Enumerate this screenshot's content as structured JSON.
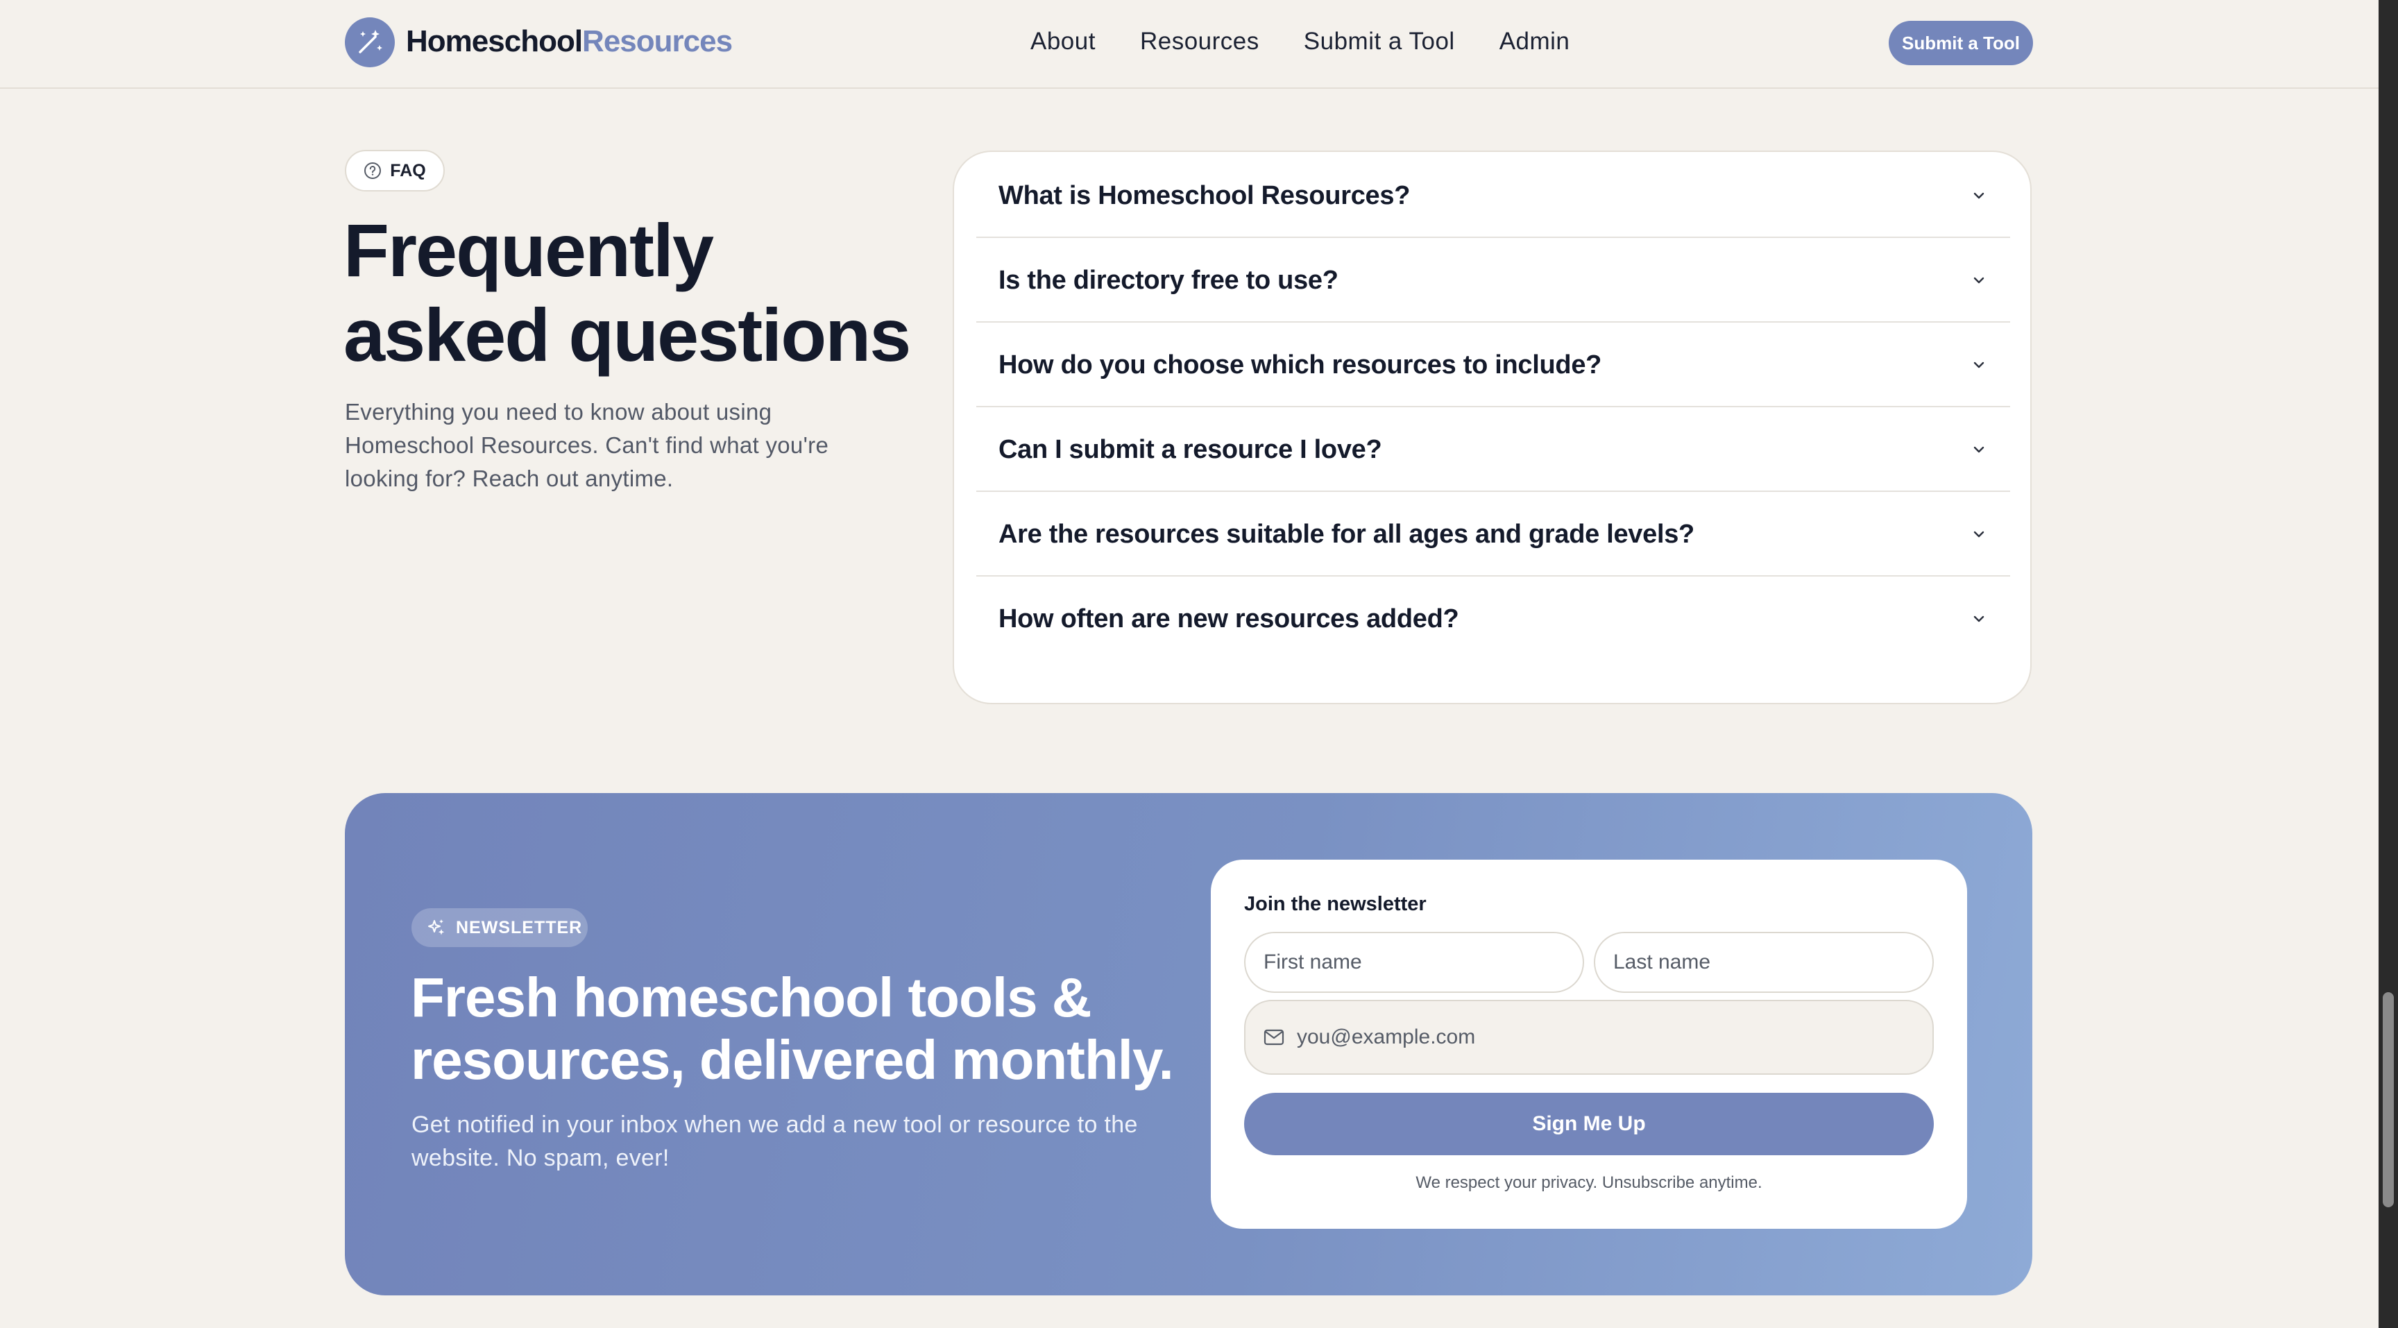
{
  "header": {
    "brand_dark": "Homeschool",
    "brand_accent": "Resources",
    "nav": [
      "About",
      "Resources",
      "Submit a Tool",
      "Admin"
    ],
    "cta": "Submit a Tool"
  },
  "faq": {
    "badge": "FAQ",
    "title_line1": "Frequently",
    "title_line2": "asked questions",
    "subtitle": "Everything you need to know about using Homeschool Resources. Can't find what you're looking for? Reach out anytime.",
    "questions": [
      "What is Homeschool Resources?",
      "Is the directory free to use?",
      "How do you choose which resources to include?",
      "Can I submit a resource I love?",
      "Are the resources suitable for all ages and grade levels?",
      "How often are new resources added?"
    ]
  },
  "newsletter": {
    "badge": "NEWSLETTER",
    "title_line1": "Fresh homeschool tools &",
    "title_line2": "resources, delivered monthly.",
    "subtitle": "Get notified in your inbox when we add a new tool or resource to the website. No spam, ever!",
    "form_label": "Join the newsletter",
    "first_name_placeholder": "First name",
    "last_name_placeholder": "Last name",
    "email_placeholder": "you@example.com",
    "button": "Sign Me Up",
    "privacy": "We respect your privacy. Unsubscribe anytime."
  },
  "colors": {
    "accent": "#7486bb",
    "background": "#f4f1ec",
    "heading": "#141a2b"
  }
}
